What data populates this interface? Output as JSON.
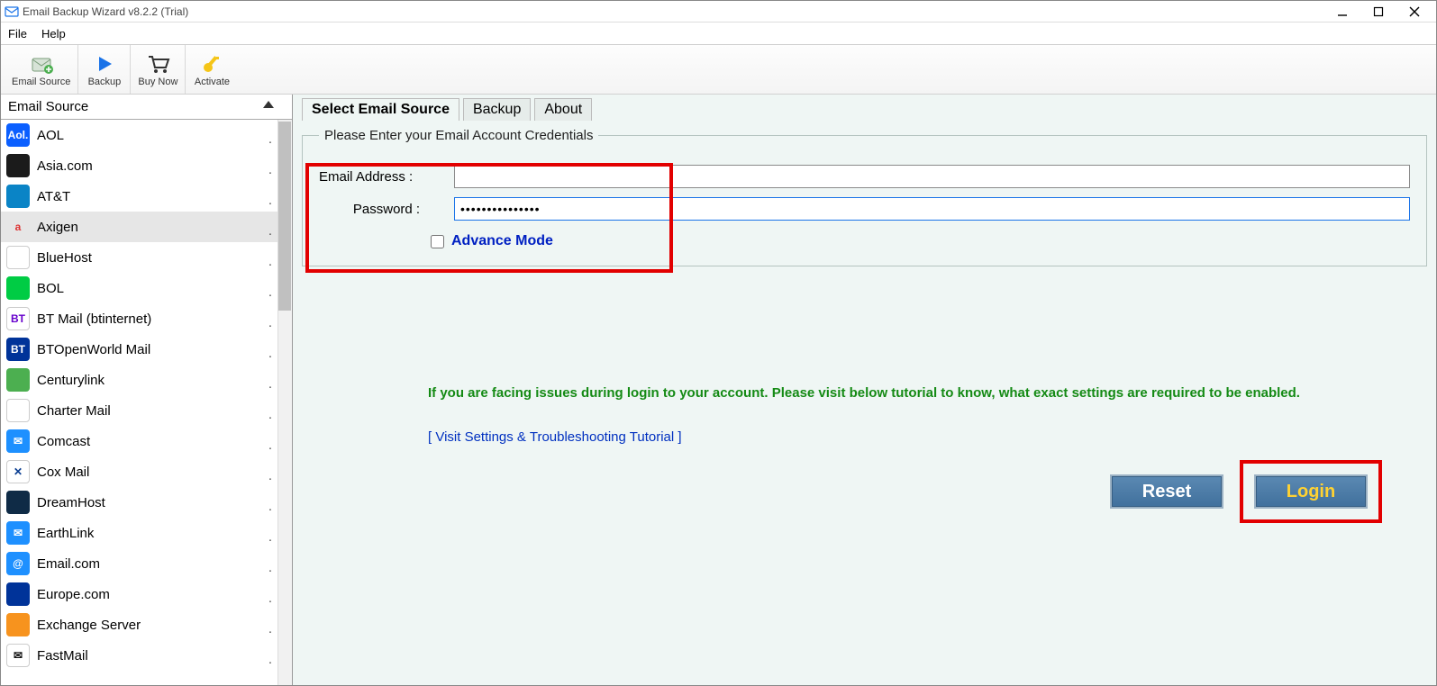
{
  "titlebar": {
    "text": "Email Backup Wizard v8.2.2 (Trial)"
  },
  "menubar": {
    "file": "File",
    "help": "Help"
  },
  "toolbar": {
    "email_source": "Email Source",
    "backup": "Backup",
    "buy_now": "Buy Now",
    "activate": "Activate"
  },
  "sidebar": {
    "header": "Email Source",
    "items": [
      {
        "label": "AOL",
        "bg": "#0b5fff",
        "txt": "Aol."
      },
      {
        "label": "Asia.com",
        "bg": "#1b1b1b",
        "txt": ""
      },
      {
        "label": "AT&T",
        "bg": "#0a84c6",
        "txt": ""
      },
      {
        "label": "Axigen",
        "bg": "#e6e6e6",
        "txt": "a",
        "selected": true,
        "txtcolor": "#d33"
      },
      {
        "label": "BlueHost",
        "bg": "#ffffff",
        "txt": ""
      },
      {
        "label": "BOL",
        "bg": "#0c4",
        "txt": ""
      },
      {
        "label": "BT Mail (btinternet)",
        "bg": "#ffffff",
        "txt": "BT",
        "txtcolor": "#6600cc"
      },
      {
        "label": "BTOpenWorld Mail",
        "bg": "#003399",
        "txt": "BT"
      },
      {
        "label": "Centurylink",
        "bg": "#4caf50",
        "txt": ""
      },
      {
        "label": "Charter Mail",
        "bg": "#ffffff",
        "txt": ""
      },
      {
        "label": "Comcast",
        "bg": "#1e90ff",
        "txt": "✉",
        "txtcolor": "#fff"
      },
      {
        "label": "Cox Mail",
        "bg": "#ffffff",
        "txt": "✕",
        "txtcolor": "#0a3d91"
      },
      {
        "label": "DreamHost",
        "bg": "#0f2b46",
        "txt": ""
      },
      {
        "label": "EarthLink",
        "bg": "#1e90ff",
        "txt": "✉",
        "txtcolor": "#fff"
      },
      {
        "label": "Email.com",
        "bg": "#1e90ff",
        "txt": "@"
      },
      {
        "label": "Europe.com",
        "bg": "#003399",
        "txt": ""
      },
      {
        "label": "Exchange Server",
        "bg": "#f7931e",
        "txt": ""
      },
      {
        "label": "FastMail",
        "bg": "#ffffff",
        "txt": "✉",
        "txtcolor": "#111"
      }
    ]
  },
  "tabs": {
    "select": "Select Email Source",
    "backup": "Backup",
    "about": "About"
  },
  "creds": {
    "legend": "Please Enter your Email Account Credentials",
    "email_label": "Email Address :",
    "email_value": "",
    "password_label": "Password :",
    "password_value": "•••••••••••••••",
    "advance": "Advance Mode"
  },
  "info": "If you are facing issues during login to your account. Please visit below tutorial to know, what exact settings are required to be enabled.",
  "tutorial": "[ Visit Settings & Troubleshooting Tutorial ]",
  "buttons": {
    "reset": "Reset",
    "login": "Login"
  }
}
